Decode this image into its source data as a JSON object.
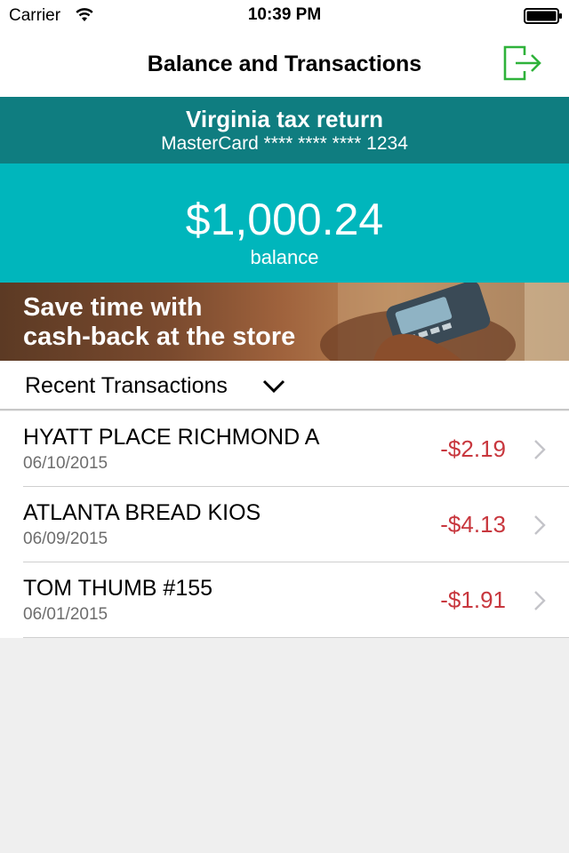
{
  "status_bar": {
    "carrier": "Carrier",
    "time": "10:39 PM",
    "wifi_icon": "wifi-icon",
    "battery_icon": "battery-icon"
  },
  "nav": {
    "title": "Balance and Transactions",
    "logout_icon": "logout-icon",
    "accent_color": "#2fb23a"
  },
  "account": {
    "name": "Virginia tax return",
    "card": "MasterCard **** **** **** 1234",
    "header_color": "#0f7d80"
  },
  "balance": {
    "amount": "$1,000.24",
    "label": "balance",
    "panel_color": "#00b6bc"
  },
  "promo": {
    "line1": "Save time with",
    "line2": "cash-back at the store"
  },
  "recent": {
    "label": "Recent Transactions",
    "toggle_icon": "chevron-down-icon"
  },
  "transactions": [
    {
      "merchant": "HYATT PLACE RICHMOND A",
      "date": "06/10/2015",
      "amount": "-$2.19"
    },
    {
      "merchant": "ATLANTA BREAD KIOS",
      "date": "06/09/2015",
      "amount": "-$4.13"
    },
    {
      "merchant": "TOM THUMB #155",
      "date": "06/01/2015",
      "amount": "-$1.91"
    }
  ],
  "colors": {
    "debit_amount": "#c8373e",
    "background": "#efefef"
  }
}
